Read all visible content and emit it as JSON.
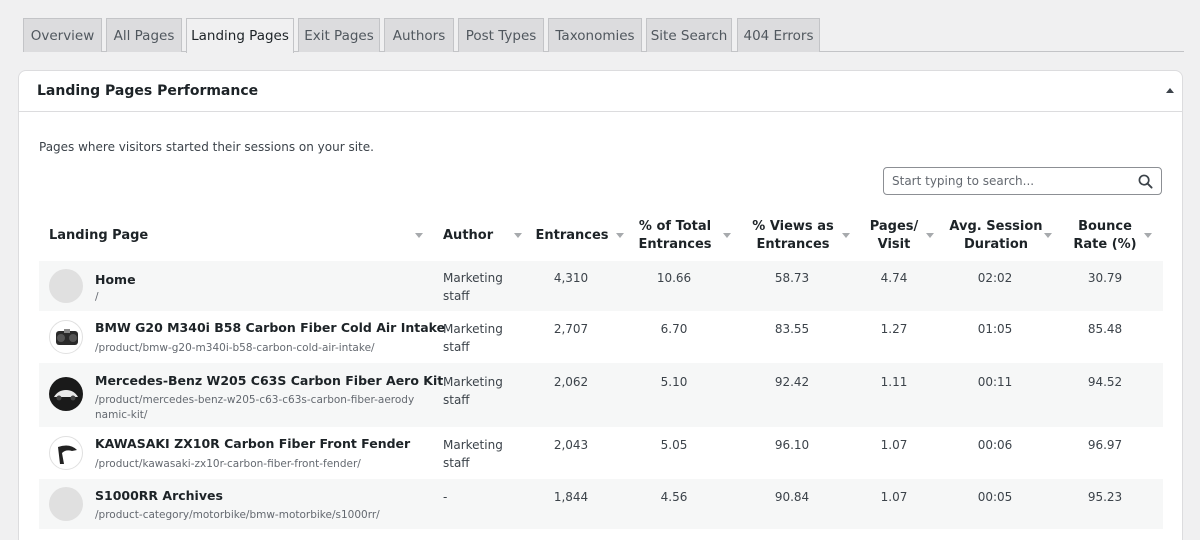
{
  "tabs": [
    {
      "label": "Overview"
    },
    {
      "label": "All Pages"
    },
    {
      "label": "Landing Pages",
      "active": true
    },
    {
      "label": "Exit Pages"
    },
    {
      "label": "Authors"
    },
    {
      "label": "Post Types"
    },
    {
      "label": "Taxonomies"
    },
    {
      "label": "Site Search"
    },
    {
      "label": "404 Errors"
    }
  ],
  "panel": {
    "title": "Landing Pages Performance",
    "description": "Pages where visitors started their sessions on your site.",
    "search_placeholder": "Start typing to search..."
  },
  "table": {
    "columns": [
      {
        "line1": "Landing Page",
        "line2": ""
      },
      {
        "line1": "Author",
        "line2": ""
      },
      {
        "line1": "Entrances",
        "line2": ""
      },
      {
        "line1": "% of Total",
        "line2": "Entrances"
      },
      {
        "line1": "% Views as",
        "line2": "Entrances"
      },
      {
        "line1": "Pages/",
        "line2": "Visit"
      },
      {
        "line1": "Avg. Session",
        "line2": "Duration"
      },
      {
        "line1": "Bounce",
        "line2": "Rate (%)"
      }
    ],
    "rows": [
      {
        "title": "Home",
        "path": "/",
        "author_l1": "Marketing",
        "author_l2": "staff",
        "entrances": "4,310",
        "pct_total": "10.66",
        "pct_views": "58.73",
        "pages_visit": "4.74",
        "duration": "02:02",
        "bounce": "30.79",
        "thumb": "placeholder"
      },
      {
        "title": "BMW G20 M340i B58 Carbon Fiber Cold Air Intake",
        "path": "/product/bmw-g20-m340i-b58-carbon-cold-air-intake/",
        "author_l1": "Marketing",
        "author_l2": "staff",
        "entrances": "2,707",
        "pct_total": "6.70",
        "pct_views": "83.55",
        "pages_visit": "1.27",
        "duration": "01:05",
        "bounce": "85.48",
        "thumb": "intake-image"
      },
      {
        "title": "Mercedes-Benz W205 C63S Carbon Fiber Aero Kit",
        "path": "/product/mercedes-benz-w205-c63-c63s-carbon-fiber-aerodynamic-kit/",
        "author_l1": "Marketing",
        "author_l2": "staff",
        "entrances": "2,062",
        "pct_total": "5.10",
        "pct_views": "92.42",
        "pages_visit": "1.11",
        "duration": "00:11",
        "bounce": "94.52",
        "thumb": "car-image"
      },
      {
        "title": "KAWASAKI ZX10R Carbon Fiber Front Fender",
        "path": "/product/kawasaki-zx10r-carbon-fiber-front-fender/",
        "author_l1": "Marketing",
        "author_l2": "staff",
        "entrances": "2,043",
        "pct_total": "5.05",
        "pct_views": "96.10",
        "pages_visit": "1.07",
        "duration": "00:06",
        "bounce": "96.97",
        "thumb": "fender-image"
      },
      {
        "title": "S1000RR Archives",
        "path": "/product-category/motorbike/bmw-motorbike/s1000rr/",
        "author_l1": "-",
        "author_l2": "",
        "entrances": "1,844",
        "pct_total": "4.56",
        "pct_views": "90.84",
        "pages_visit": "1.07",
        "duration": "00:05",
        "bounce": "95.23",
        "thumb": "placeholder"
      }
    ]
  }
}
